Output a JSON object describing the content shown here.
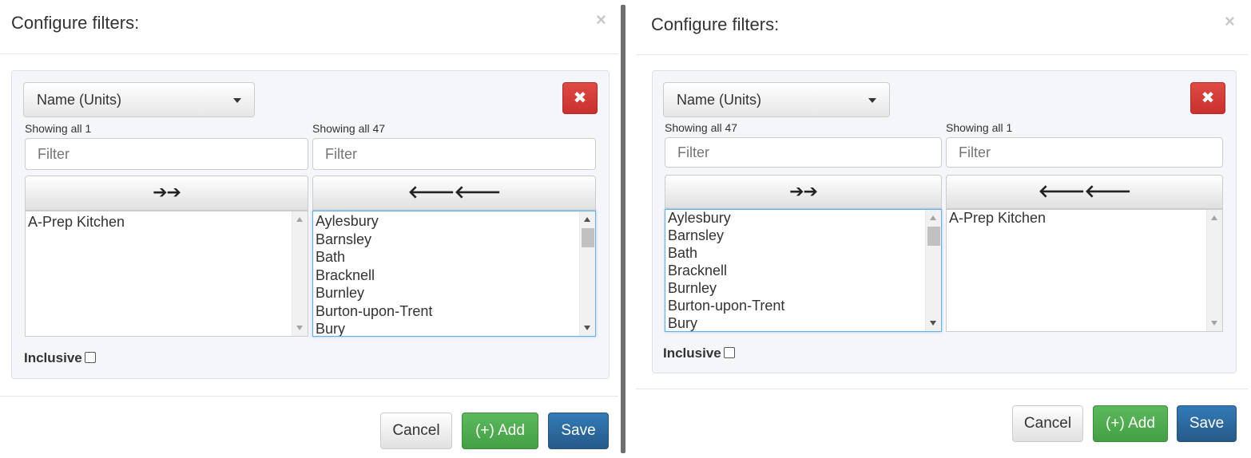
{
  "dialogs": [
    {
      "title": "Configure filters:",
      "close_label": "×",
      "field_select": {
        "value": "Name (Units)"
      },
      "remove_label": "✖",
      "left_list": {
        "showing": "Showing all 1",
        "filter_placeholder": "Filter",
        "move_label": "➔➔",
        "items": [
          "A-Prep Kitchen"
        ]
      },
      "right_list": {
        "showing": "Showing all 47",
        "filter_placeholder": "Filter",
        "move_label": "🡐🡐",
        "items": [
          "Aylesbury",
          "Barnsley",
          "Bath",
          "Bracknell",
          "Burnley",
          "Burton-upon-Trent",
          "Bury"
        ]
      },
      "inclusive_label": "Inclusive",
      "buttons": {
        "cancel": "Cancel",
        "add": "(+) Add",
        "save": "Save"
      }
    },
    {
      "title": "Configure filters:",
      "close_label": "×",
      "field_select": {
        "value": "Name (Units)"
      },
      "remove_label": "✖",
      "left_list": {
        "showing": "Showing all 47",
        "filter_placeholder": "Filter",
        "move_label": "➔➔",
        "items": [
          "Aylesbury",
          "Barnsley",
          "Bath",
          "Bracknell",
          "Burnley",
          "Burton-upon-Trent",
          "Bury"
        ]
      },
      "right_list": {
        "showing": "Showing all 1",
        "filter_placeholder": "Filter",
        "move_label": "🡐🡐",
        "items": [
          "A-Prep Kitchen"
        ]
      },
      "inclusive_label": "Inclusive",
      "buttons": {
        "cancel": "Cancel",
        "add": "(+) Add",
        "save": "Save"
      }
    }
  ],
  "icons": {
    "move_right": "double-arrow-right-icon",
    "move_left": "double-arrow-left-icon",
    "remove": "remove-x-icon",
    "close": "close-icon",
    "caret": "chevron-down-icon"
  },
  "colors": {
    "danger": "#d9534f",
    "success": "#5cb85c",
    "primary": "#337ab7",
    "panel_bg": "#f5f6f9",
    "focus": "#66afe9"
  }
}
